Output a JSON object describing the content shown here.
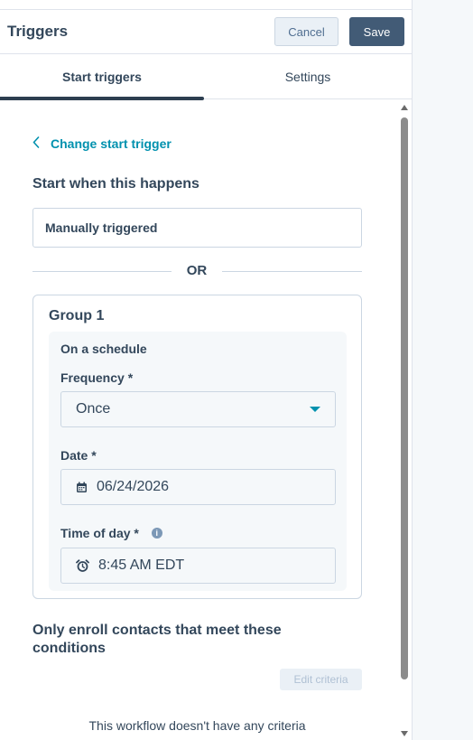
{
  "header": {
    "title": "Triggers",
    "cancel_label": "Cancel",
    "save_label": "Save"
  },
  "tabs": [
    {
      "label": "Start triggers",
      "active": true
    },
    {
      "label": "Settings",
      "active": false
    }
  ],
  "change_trigger": {
    "label": "Change start trigger",
    "icon": "chevron-left-icon"
  },
  "start_section": {
    "title": "Start when this happens",
    "manual_trigger": "Manually triggered"
  },
  "divider": {
    "label": "OR"
  },
  "group": {
    "title": "Group 1",
    "schedule_title": "On a schedule",
    "frequency_label": "Frequency *",
    "frequency_value": "Once",
    "date_label": "Date *",
    "date_value": "06/24/2026",
    "date_icon": "calendar-icon",
    "time_label": "Time of day *",
    "time_info_icon": "info-icon",
    "time_value": "8:45 AM EDT",
    "time_icon": "alarm-clock-icon"
  },
  "enrollment": {
    "title": "Only enroll contacts that meet these conditions",
    "edit_label": "Edit criteria",
    "empty_text": "This workflow doesn't have any criteria"
  },
  "colors": {
    "link": "#0091ae",
    "text": "#33475b",
    "save_bg": "#425b76",
    "border": "#cbd6e2",
    "panel_bg": "#f5f8fa"
  }
}
